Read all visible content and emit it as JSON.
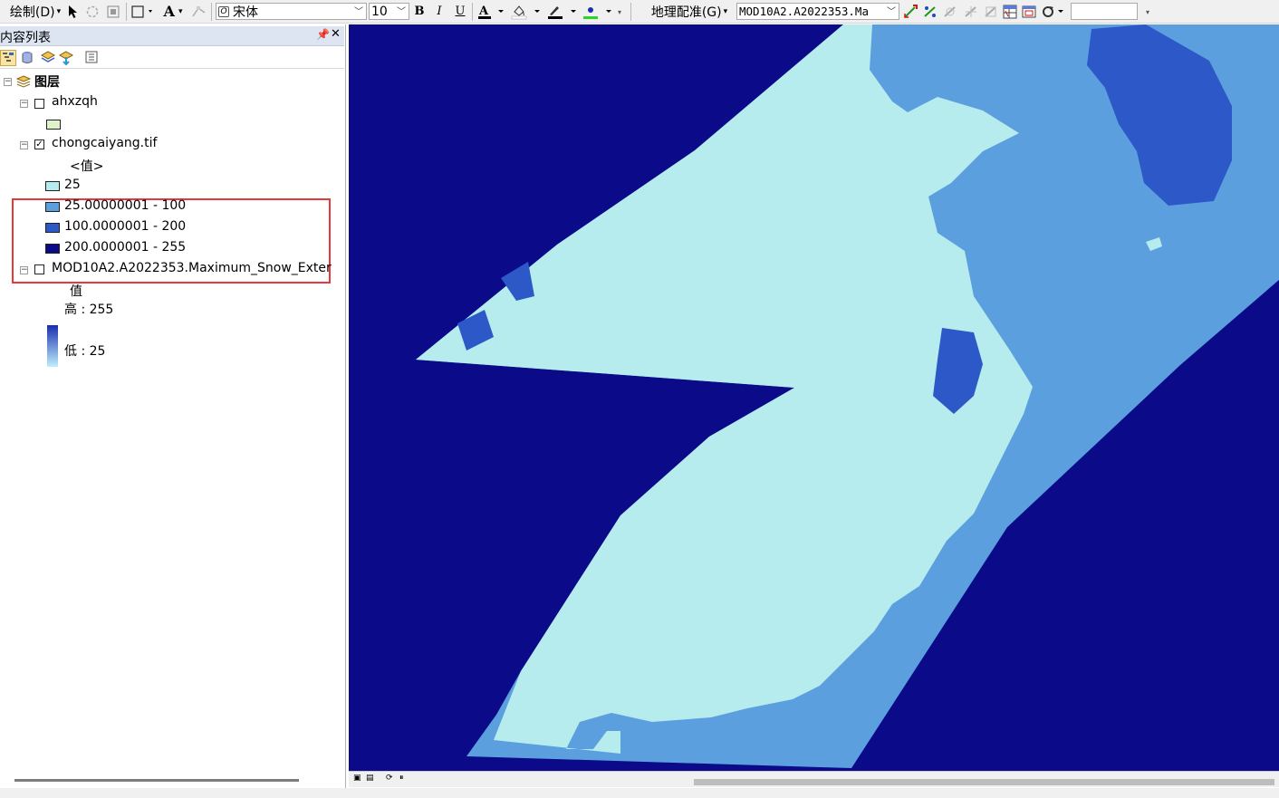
{
  "toolbar": {
    "draw_menu": "绘制(D)",
    "font_name": "宋体",
    "font_size": "10",
    "bold": "B",
    "italic": "I",
    "underline": "U",
    "text_a": "A",
    "georef_menu": "地理配准(G)",
    "layer_combo": "MOD10A2.A2022353.Ma",
    "search_value": ""
  },
  "toc": {
    "title": "内容列表",
    "root_label": "图层",
    "layers": [
      {
        "name": "ahxzqh",
        "checked": false
      },
      {
        "name": "chongcaiyang.tif",
        "checked": true,
        "field": "<值>",
        "classes": [
          {
            "label": "25",
            "color": "#b7ecef"
          },
          {
            "label": "25.00000001 - 100",
            "color": "#5b9fdf"
          },
          {
            "label": "100.0000001 - 200",
            "color": "#2c58c8"
          },
          {
            "label": "200.0000001 - 255",
            "color": "#0b0b8a"
          }
        ]
      },
      {
        "name": "MOD10A2.A2022353.Maximum_Snow_Exter",
        "checked": false,
        "field": "值",
        "high_label": "高 : 255",
        "low_label": "低 : 25"
      }
    ]
  },
  "colors": {
    "no_data": "#0b0b8a",
    "ocean_land_class": "#5b9fdf",
    "snow_free": "#b7ecef",
    "snow_class": "#2c58c8",
    "highlight_box": "#e5393b",
    "ahxzqh_fill": "#dff2c9"
  }
}
